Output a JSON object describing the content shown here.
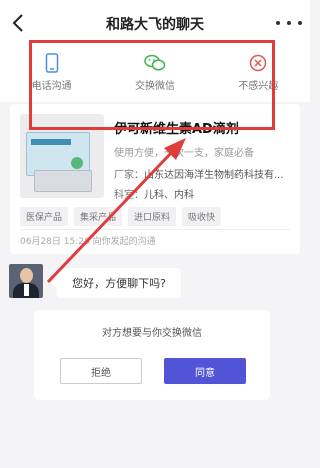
{
  "header": {
    "back_icon": "chevron-left-icon",
    "title": "和路大飞的聊天",
    "more_icon": "more-dots-icon"
  },
  "actions": [
    {
      "label": "电话沟通",
      "icon": "phone-icon",
      "color": "#4a8fe0"
    },
    {
      "label": "交换微信",
      "icon": "wechat-icon",
      "color": "#3fb34f"
    },
    {
      "label": "不感兴趣",
      "icon": "close-circle-icon",
      "color": "#e05a4a"
    }
  ],
  "product": {
    "name": "伊可新维生素AD滴剂",
    "desc": "使用方便，一次一支，家庭必备",
    "maker_label": "厂家：",
    "maker": "山东达因海洋生物制药科技有...",
    "dept_label": "科室：",
    "dept": "儿科、内科",
    "tags": [
      "医保产品",
      "集采产品",
      "进口原料",
      "吸收快"
    ],
    "footer": "06月28日 15:28 向你发起的沟通"
  },
  "chat": {
    "message": "您好，方便聊下吗?"
  },
  "request": {
    "text": "对方想要与你交换微信",
    "reject": "拒绝",
    "agree": "同意"
  },
  "colors": {
    "accent": "#5154d6",
    "highlight": "#e03c3c"
  }
}
